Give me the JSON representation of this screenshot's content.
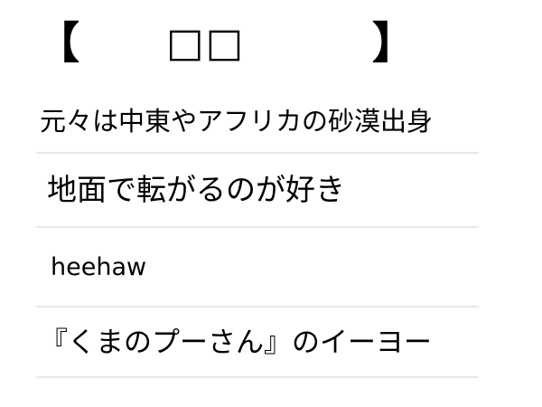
{
  "title": {
    "open_bracket": "【",
    "text": "□□",
    "close_bracket": "】"
  },
  "clues": [
    {
      "text": "元々は中東やアフリカの砂漠出身"
    },
    {
      "text": "地面で転がるのが好き"
    },
    {
      "text": "heehaw"
    },
    {
      "text": "『くまのプーさん』のイーヨー"
    }
  ]
}
